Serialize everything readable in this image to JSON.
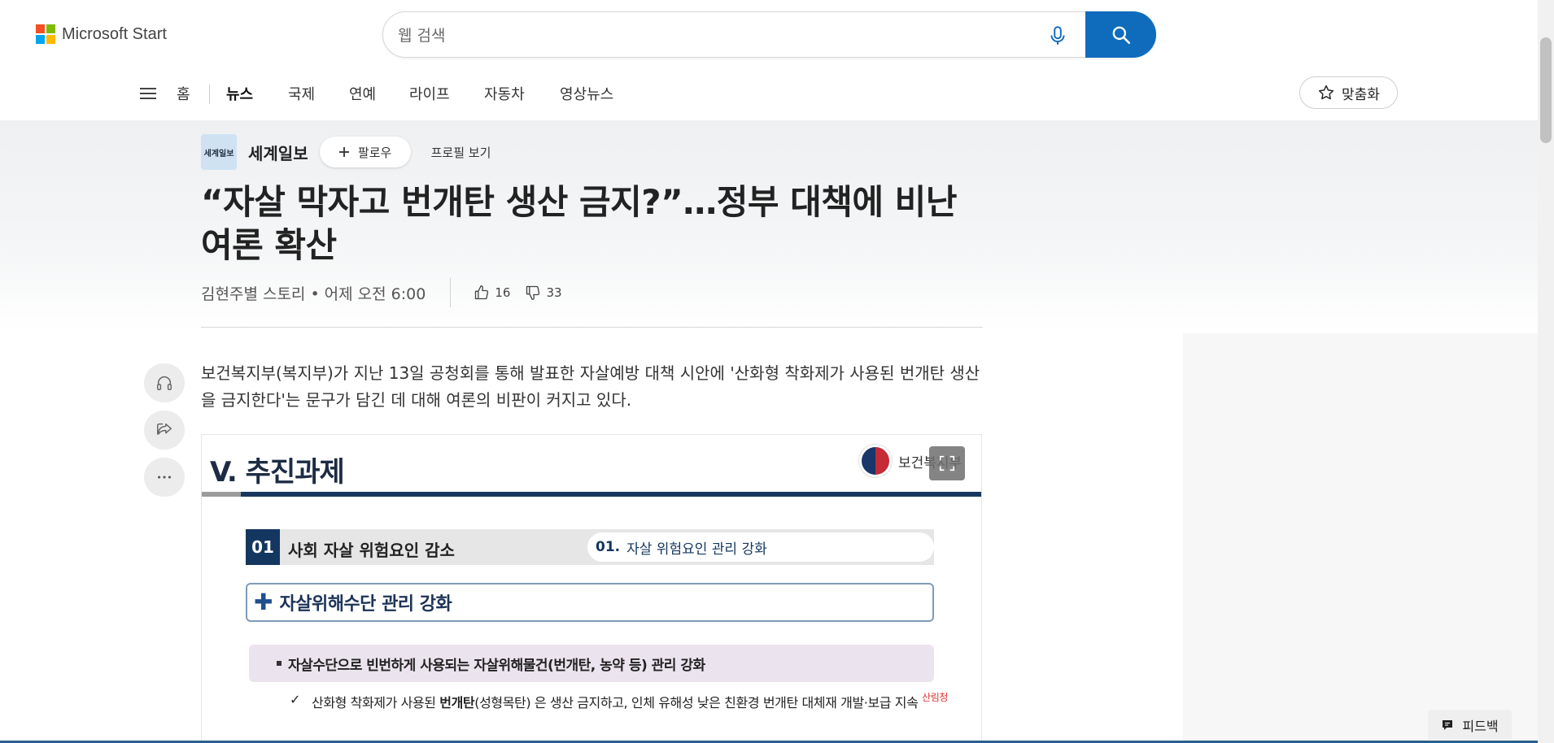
{
  "header": {
    "logo_text": "Microsoft Start",
    "logo_colors": [
      "#f25022",
      "#7fba00",
      "#00a4ef",
      "#ffb900"
    ],
    "search_placeholder": "웹 검색",
    "accent_color": "#0f6cbd"
  },
  "nav": {
    "items": [
      {
        "label": "홈"
      },
      {
        "label": "뉴스",
        "active": true
      },
      {
        "label": "국제"
      },
      {
        "label": "연예"
      },
      {
        "label": "라이프"
      },
      {
        "label": "자동차"
      },
      {
        "label": "영상뉴스"
      }
    ],
    "personalize_label": "맞춤화"
  },
  "article": {
    "publisher": "세계일보",
    "publisher_logo_text": "세계일보",
    "follow_label": "팔로우",
    "profile_label": "프로필 보기",
    "title": "“자살 막자고 번개탄 생산 금지?”…정부 대책에 비난여론 확산",
    "byline": "김현주별 스토리 • 어제 오전 6:00",
    "likes": "16",
    "dislikes": "33",
    "lead": "보건복지부(복지부)가 지난 13일 공청회를 통해 발표한 자살예방 대책 시안에 '산화형 착화제가 사용된 번개탄 생산을 금지한다'는 문구가 담긴 데 대해 여론의 비판이 커지고 있다."
  },
  "figure": {
    "title": "V. 추진과제",
    "ministry": "보건복지부",
    "row_number": "01",
    "row_text": "사회 자살 위험요인 감소",
    "sub_number": "01.",
    "sub_text": "자살 위험요인 관리 강화",
    "box_title": "자살위해수단 관리 강화",
    "bullet": "자살수단으로 빈번하게 사용되는 자살위해물건(번개탄, 농약 등) 관리 강화",
    "check_prefix": "산화형 착화제가 사용된 ",
    "check_bold": "번개탄",
    "check_suffix": "(성형목탄) 은 생산 금지하고, 인체 유해성 낮은 친환경 번개탄 대체재 개발·보급 지속",
    "agency_tag": "산림청"
  },
  "feedback_label": "피드백"
}
